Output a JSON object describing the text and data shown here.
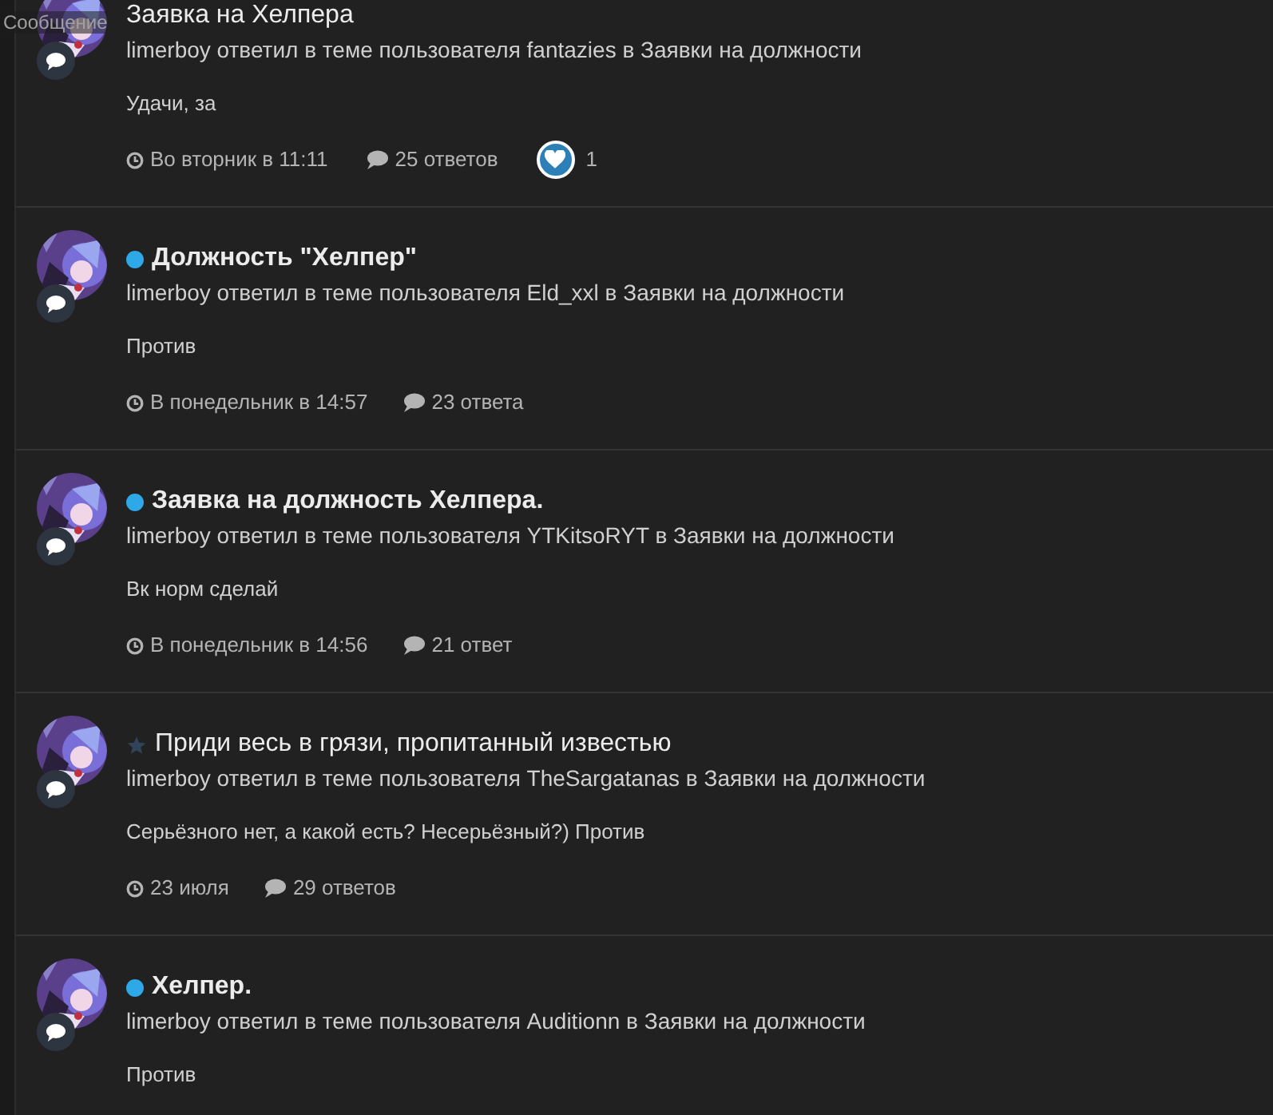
{
  "tooltip": "Сообщение",
  "items": [
    {
      "title": "Заявка на Хелпера",
      "unread": false,
      "starred": false,
      "byline": "limerboy ответил в теме пользователя fantazies в Заявки на должности",
      "excerpt": "Удачи, за",
      "time": "Во вторник в 11:11",
      "replies": "25 ответов",
      "likes": "1"
    },
    {
      "title": "Должность \"Хелпер\"",
      "unread": true,
      "starred": false,
      "byline": "limerboy ответил в теме пользователя Eld_xxl в Заявки на должности",
      "excerpt": "Против",
      "time": "В понедельник в 14:57",
      "replies": "23 ответа"
    },
    {
      "title": "Заявка на должность Хелпера.",
      "unread": true,
      "starred": false,
      "byline": "limerboy ответил в теме пользователя YTKitsoRYT в Заявки на должности",
      "excerpt": "Вк норм сделай",
      "time": "В понедельник в 14:56",
      "replies": "21 ответ"
    },
    {
      "title": "Приди весь в грязи, пропитанный известью",
      "unread": false,
      "starred": true,
      "byline": "limerboy ответил в теме пользователя TheSargatanas в Заявки на должности",
      "excerpt": "Серьёзного нет, а какой есть? Несерьёзный?) Против",
      "time": "23 июля",
      "replies": "29 ответов"
    },
    {
      "title": "Хелпер.",
      "unread": true,
      "starred": false,
      "byline": "limerboy ответил в теме пользователя Auditionn в Заявки на должности",
      "excerpt": "Против"
    }
  ]
}
